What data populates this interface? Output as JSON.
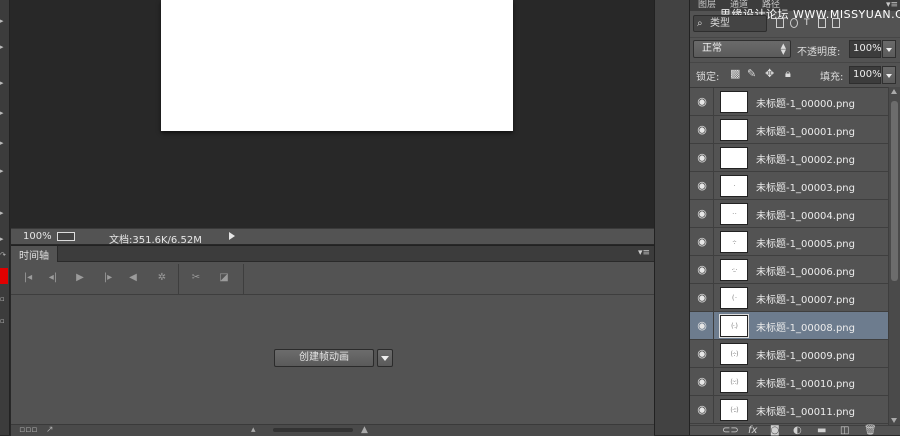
{
  "statusbar": {
    "zoom": "100%",
    "doc_info": "文档:351.6K/6.52M"
  },
  "timeline": {
    "tab_label": "时间轴",
    "menu_icon": "panel-menu-icon",
    "controls": [
      "first-frame-icon",
      "prev-frame-icon",
      "play-icon",
      "next-frame-icon",
      "audio-icon",
      "settings-icon",
      "scissors-icon",
      "transition-icon"
    ],
    "create_frame_label": "创建帧动画"
  },
  "layers_panel": {
    "tabs": [
      "图层",
      "通道",
      "路径"
    ],
    "watermark": "思缘设计论坛 WWW.MISSYUAN.COM",
    "filter": {
      "label": "类型"
    },
    "blend_mode": "正常",
    "opacity_label": "不透明度:",
    "opacity_value": "100%",
    "lock_label": "锁定:",
    "fill_label": "填充:",
    "fill_value": "100%",
    "layers": [
      {
        "name": "未标题-1_00000.png",
        "selected": false
      },
      {
        "name": "未标题-1_00001.png",
        "selected": false
      },
      {
        "name": "未标题-1_00002.png",
        "selected": false
      },
      {
        "name": "未标题-1_00003.png",
        "selected": false
      },
      {
        "name": "未标题-1_00004.png",
        "selected": false
      },
      {
        "name": "未标题-1_00005.png",
        "selected": false
      },
      {
        "name": "未标题-1_00006.png",
        "selected": false
      },
      {
        "name": "未标题-1_00007.png",
        "selected": false
      },
      {
        "name": "未标题-1_00008.png",
        "selected": true
      },
      {
        "name": "未标题-1_00009.png",
        "selected": false
      },
      {
        "name": "未标题-1_00010.png",
        "selected": false
      },
      {
        "name": "未标题-1_00011.png",
        "selected": false
      }
    ],
    "footer_icons": [
      "link-icon",
      "fx-icon",
      "mask-icon",
      "adjustment-icon",
      "group-icon",
      "new-layer-icon",
      "delete-icon"
    ]
  },
  "colors": {
    "foreground_swatch": "#e00000",
    "selected_row": "#6d7c8e"
  }
}
